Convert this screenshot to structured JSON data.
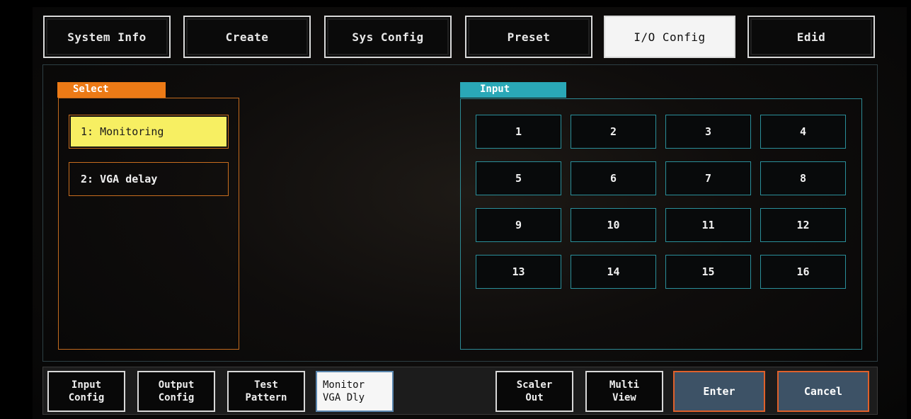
{
  "top_tabs": [
    {
      "label": "System Info"
    },
    {
      "label": "Create"
    },
    {
      "label": "Sys Config"
    },
    {
      "label": "Preset"
    },
    {
      "label": "I/O Config"
    },
    {
      "label": "Edid"
    }
  ],
  "select_panel": {
    "title": "Select",
    "items": [
      {
        "label": "1: Monitoring"
      },
      {
        "label": "2: VGA delay"
      }
    ]
  },
  "input_panel": {
    "title": "Input",
    "buttons": [
      "1",
      "2",
      "3",
      "4",
      "5",
      "6",
      "7",
      "8",
      "9",
      "10",
      "11",
      "12",
      "13",
      "14",
      "15",
      "16"
    ]
  },
  "bottom_buttons": [
    {
      "label": "Input\nConfig"
    },
    {
      "label": "Output\nConfig"
    },
    {
      "label": "Test\nPattern"
    },
    {
      "label": "Monitor\nVGA Dly"
    },
    {
      "label": "Scaler\nOut"
    },
    {
      "label": "Multi\nView"
    },
    {
      "label": "Enter"
    },
    {
      "label": "Cancel"
    }
  ],
  "colors": {
    "select_accent": "#ec7a16",
    "input_accent": "#2aa8b7",
    "selected_item": "#f7ef62",
    "action_button_fill": "#3d5266",
    "action_button_border": "#e0602a"
  }
}
